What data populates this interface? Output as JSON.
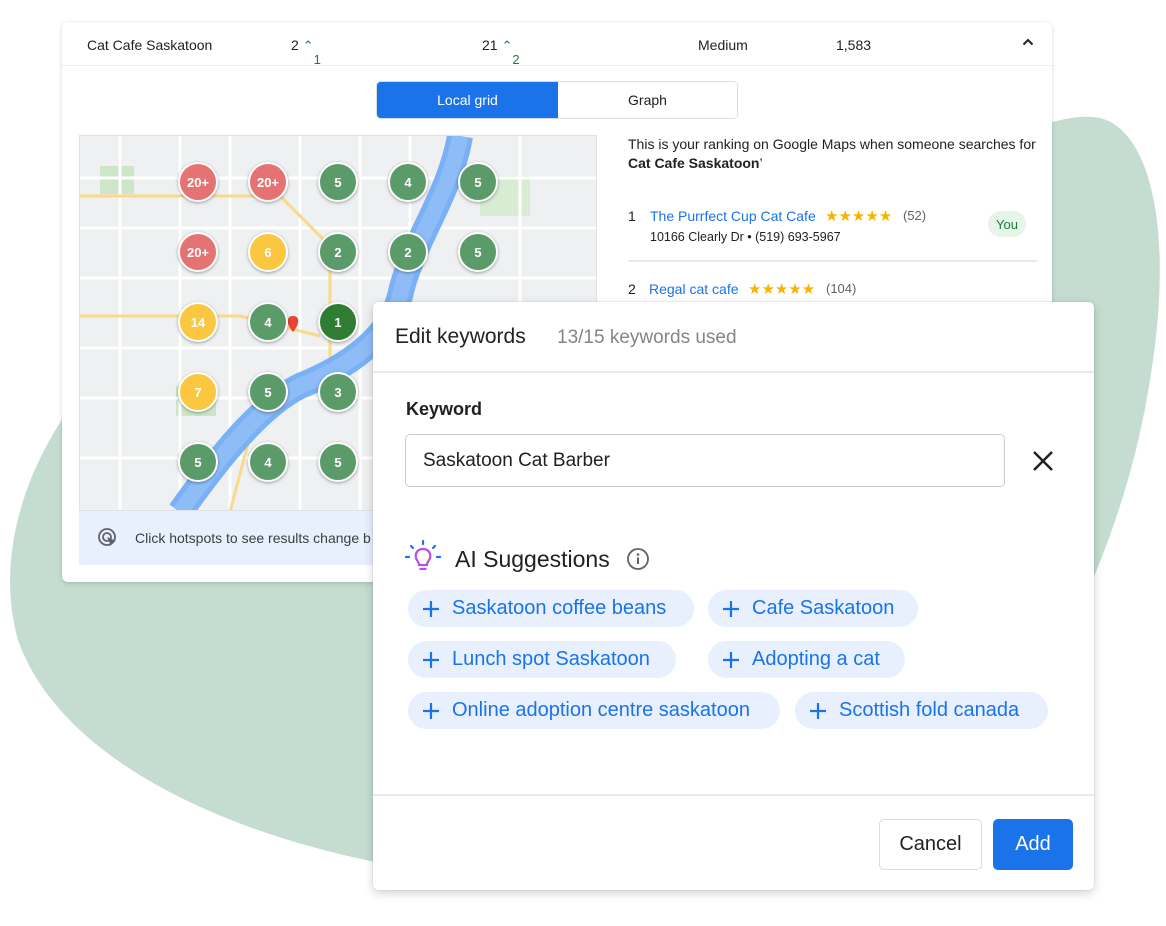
{
  "summary": {
    "keyword": "Cat Cafe Saskatoon",
    "rank_a": "2",
    "rank_a_change": "1",
    "rank_b": "21",
    "rank_b_change": "2",
    "difficulty": "Medium",
    "volume": "1,583"
  },
  "view_toggle": {
    "options": [
      "Local grid",
      "Graph"
    ],
    "selected": "Local grid"
  },
  "map": {
    "grid_values": [
      [
        "20+",
        "20+",
        "5",
        "4",
        "5"
      ],
      [
        "20+",
        "6",
        "2",
        "2",
        "5"
      ],
      [
        "14",
        "4",
        "1",
        "",
        ""
      ],
      [
        "7",
        "5",
        "3",
        "",
        ""
      ],
      [
        "5",
        "4",
        "5",
        "",
        ""
      ]
    ],
    "hint": "Click hotspots to see results change b"
  },
  "ranking": {
    "description_prefix": "This is your ranking on Google Maps when someone searches for",
    "description_keyword": "Cat Cafe Saskatoon",
    "description_suffix": "’",
    "results": [
      {
        "rank": "1",
        "name": "The Purrfect Cup Cat Cafe",
        "stars": "★★★★★",
        "reviews": "(52)",
        "address": "10166 Clearly Dr • (519) 693-5967",
        "badge": "You"
      },
      {
        "rank": "2",
        "name": "Regal cat cafe",
        "stars": "★★★★★",
        "reviews": "(104)"
      }
    ]
  },
  "modal": {
    "title": "Edit keywords",
    "usage": "13/15 keywords used",
    "keyword_label": "Keyword",
    "keyword_value": "Saskatoon Cat Barber",
    "ai_title": "AI Suggestions",
    "suggestions": [
      "Saskatoon coffee beans",
      "Cafe Saskatoon",
      "Lunch spot Saskatoon",
      "Adopting a cat",
      "Online adoption centre saskatoon",
      "Scottish fold canada"
    ],
    "cancel_label": "Cancel",
    "add_label": "Add"
  },
  "colors": {
    "accent": "#1a73e8",
    "blob": "#c4ddd0",
    "rank_red": "#e57373",
    "rank_yellow": "#fbc640",
    "rank_green": "#5b9b6a",
    "rank_dark_green": "#2e7d32",
    "positive": "#188038",
    "ai_icon": "#b44df2"
  }
}
